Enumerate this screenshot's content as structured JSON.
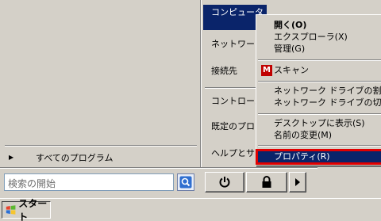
{
  "start_menu": {
    "right_items": [
      {
        "label": "コンピュータ"
      },
      {
        "label": "ネットワーク"
      },
      {
        "label": "接続先"
      },
      {
        "label": "コントロール"
      },
      {
        "label": "既定のプロク"
      },
      {
        "label": "ヘルプとサホ"
      }
    ],
    "all_programs_label": "すべてのプログラム",
    "search": {
      "placeholder": "検索の開始"
    }
  },
  "context_menu": {
    "items": [
      {
        "label": "開く(O)"
      },
      {
        "label": "エクスプローラ(X)"
      },
      {
        "label": "管理(G)"
      },
      {
        "label": "スキャン"
      },
      {
        "label": "ネットワーク ドライブの割り当て"
      },
      {
        "label": "ネットワーク ドライブの切断(C)"
      },
      {
        "label": "デスクトップに表示(S)"
      },
      {
        "label": "名前の変更(M)"
      },
      {
        "label": "プロパティ(R)"
      }
    ]
  },
  "taskbar": {
    "start_label": "スタート"
  },
  "icons": {
    "search": "search-icon",
    "power": "power-icon",
    "lock": "lock-icon",
    "arrow": "arrow-right-icon",
    "mcafee": "mcafee-icon",
    "windows": "windows-flag-icon"
  }
}
